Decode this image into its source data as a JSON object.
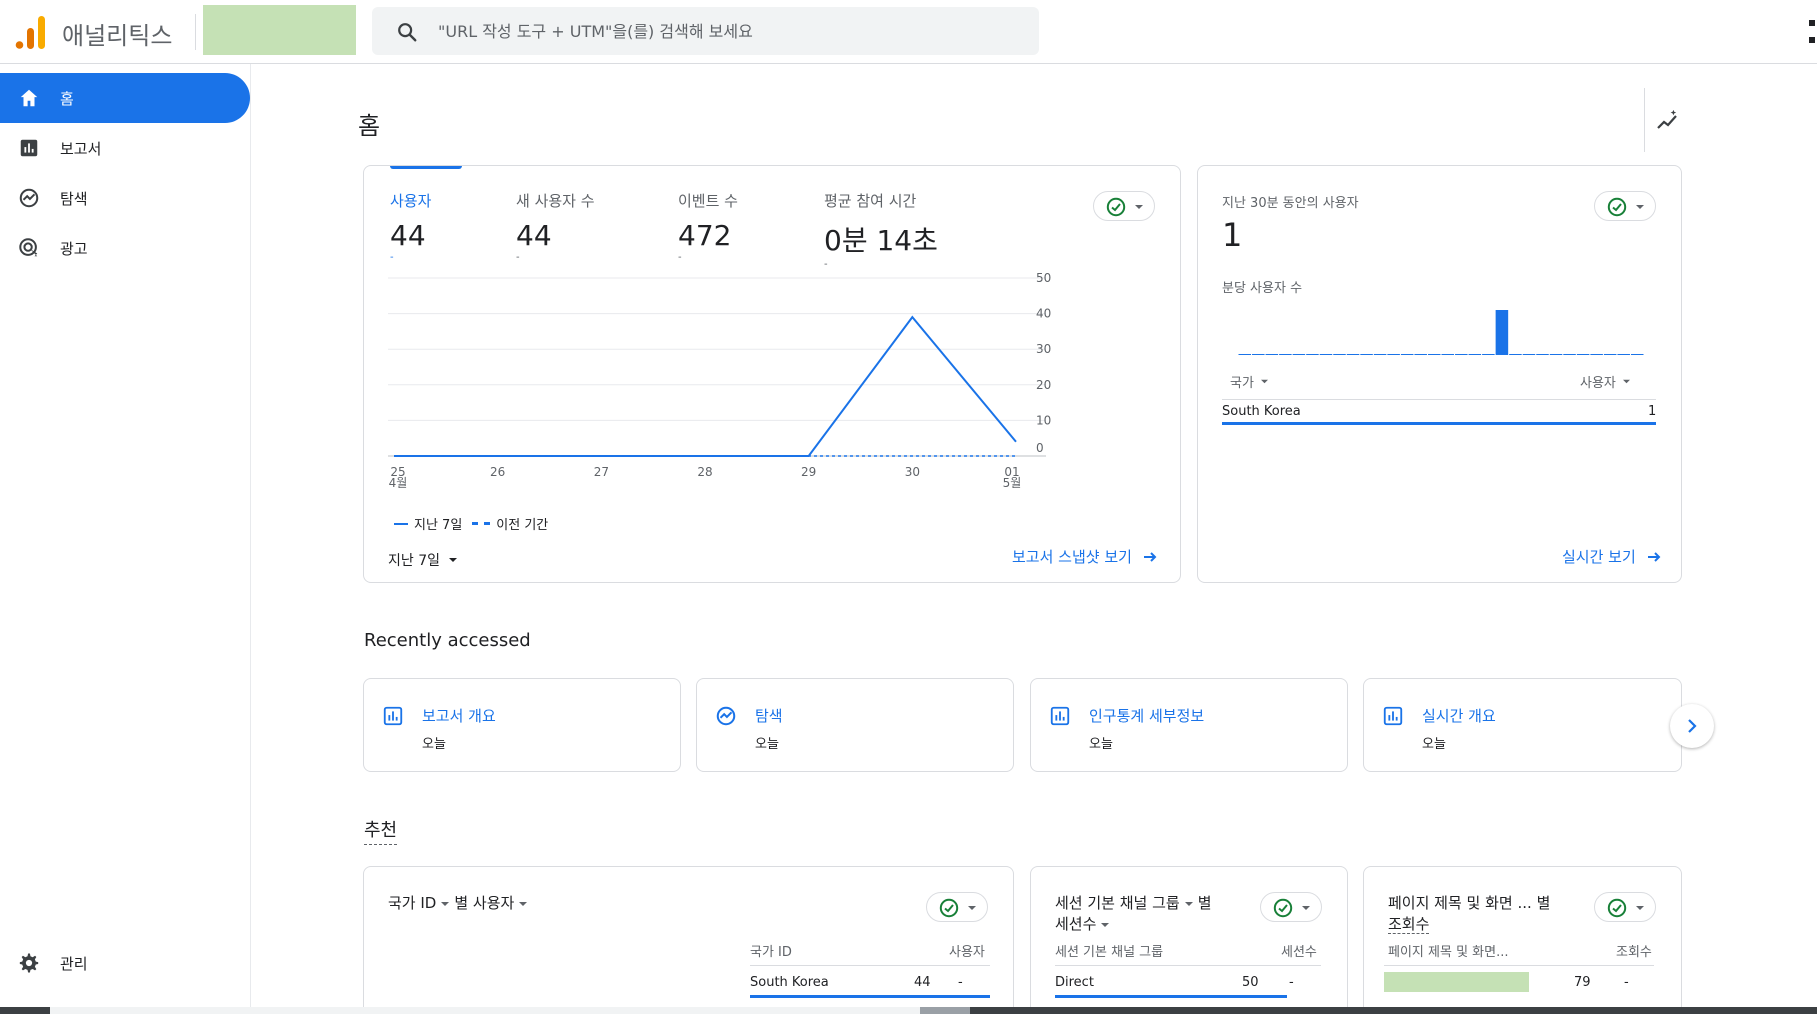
{
  "app": {
    "title": "애널리틱스"
  },
  "search": {
    "placeholder": "\"URL 작성 도구 + UTM\"을(를) 검색해 보세요"
  },
  "sidebar": {
    "items": [
      {
        "label": "홈",
        "icon": "home-icon",
        "active": true
      },
      {
        "label": "보고서",
        "icon": "bar-chart-icon"
      },
      {
        "label": "탐색",
        "icon": "explore-icon"
      },
      {
        "label": "광고",
        "icon": "ads-icon"
      }
    ],
    "admin": {
      "label": "관리",
      "icon": "gear-icon"
    }
  },
  "page": {
    "title": "홈"
  },
  "overview": {
    "metrics": [
      {
        "label": "사용자",
        "value": "44",
        "dash": "-"
      },
      {
        "label": "새 사용자 수",
        "value": "44",
        "dash": "-"
      },
      {
        "label": "이벤트 수",
        "value": "472",
        "dash": "-"
      },
      {
        "label": "평균 참여 시간",
        "value": "0분 14초",
        "dash": "-"
      }
    ],
    "legend_current": "지난 7일",
    "legend_previous": "이전 기간",
    "date_range": "지난 7일",
    "snapshot_link": "보고서 스냅샷 보기"
  },
  "chart_data": {
    "type": "line",
    "categories": [
      "25\n4월",
      "26",
      "27",
      "28",
      "29",
      "30",
      "01\n5월"
    ],
    "x_tick_top": [
      "25",
      "26",
      "27",
      "28",
      "29",
      "30",
      "01"
    ],
    "x_tick_bottom": [
      "4월",
      "",
      "",
      "",
      "",
      "",
      "5월"
    ],
    "series": [
      {
        "name": "지난 7일",
        "values": [
          0,
          0,
          0,
          0,
          0,
          39,
          4
        ],
        "style": "solid"
      },
      {
        "name": "이전 기간",
        "values": [
          0,
          0,
          0,
          0,
          0,
          0,
          0
        ],
        "style": "dashed"
      }
    ],
    "yticks": [
      0,
      10,
      20,
      30,
      40,
      50
    ],
    "ylim": [
      0,
      50
    ],
    "color": "#1a73e8",
    "grid": true
  },
  "realtime": {
    "title": "지난 30분 동안의 사용자",
    "value": "1",
    "per_minute_label": "분당 사용자 수",
    "per_minute_values": [
      0,
      0,
      0,
      0,
      0,
      0,
      0,
      0,
      0,
      0,
      0,
      0,
      0,
      0,
      0,
      0,
      0,
      0,
      0,
      1,
      0,
      0,
      0,
      0,
      0,
      0,
      0,
      0,
      0,
      0
    ],
    "col_country": "국가",
    "col_users": "사용자",
    "rows": [
      {
        "country": "South Korea",
        "users": "1"
      }
    ],
    "link": "실시간 보기"
  },
  "recent": {
    "title": "Recently accessed",
    "cards": [
      {
        "title": "보고서 개요",
        "sub": "오늘",
        "icon": "report-icon"
      },
      {
        "title": "탐색",
        "sub": "오늘",
        "icon": "explore-icon"
      },
      {
        "title": "인구통계 세부정보",
        "sub": "오늘",
        "icon": "report-icon"
      },
      {
        "title": "실시간 개요",
        "sub": "오늘",
        "icon": "report-icon"
      }
    ]
  },
  "recommend": {
    "title": "추천",
    "cards": [
      {
        "title_a": "국가 ID",
        "title_b": "별 사용자",
        "col_dim": "국가 ID",
        "col_metric": "사용자",
        "row_dim": "South Korea",
        "row_value": "44",
        "row_dash": "-"
      },
      {
        "title_a": "세션 기본 채널 그룹",
        "title_b": "별",
        "title_c": "세션수",
        "col_dim": "세션 기본 채널 그룹",
        "col_metric": "세션수",
        "row_dim": "Direct",
        "row_value": "50",
        "row_dash": "-"
      },
      {
        "title_a": "페이지 제목 및 화면 ...",
        "title_b": "별",
        "title_c": "조회수",
        "col_dim": "페이지 제목 및 화면...",
        "col_metric": "조회수",
        "row_value": "79",
        "row_dash": "-"
      }
    ]
  },
  "colors": {
    "accent": "#1a73e8",
    "redacted": "#c5e1b5",
    "success": "#188038"
  }
}
